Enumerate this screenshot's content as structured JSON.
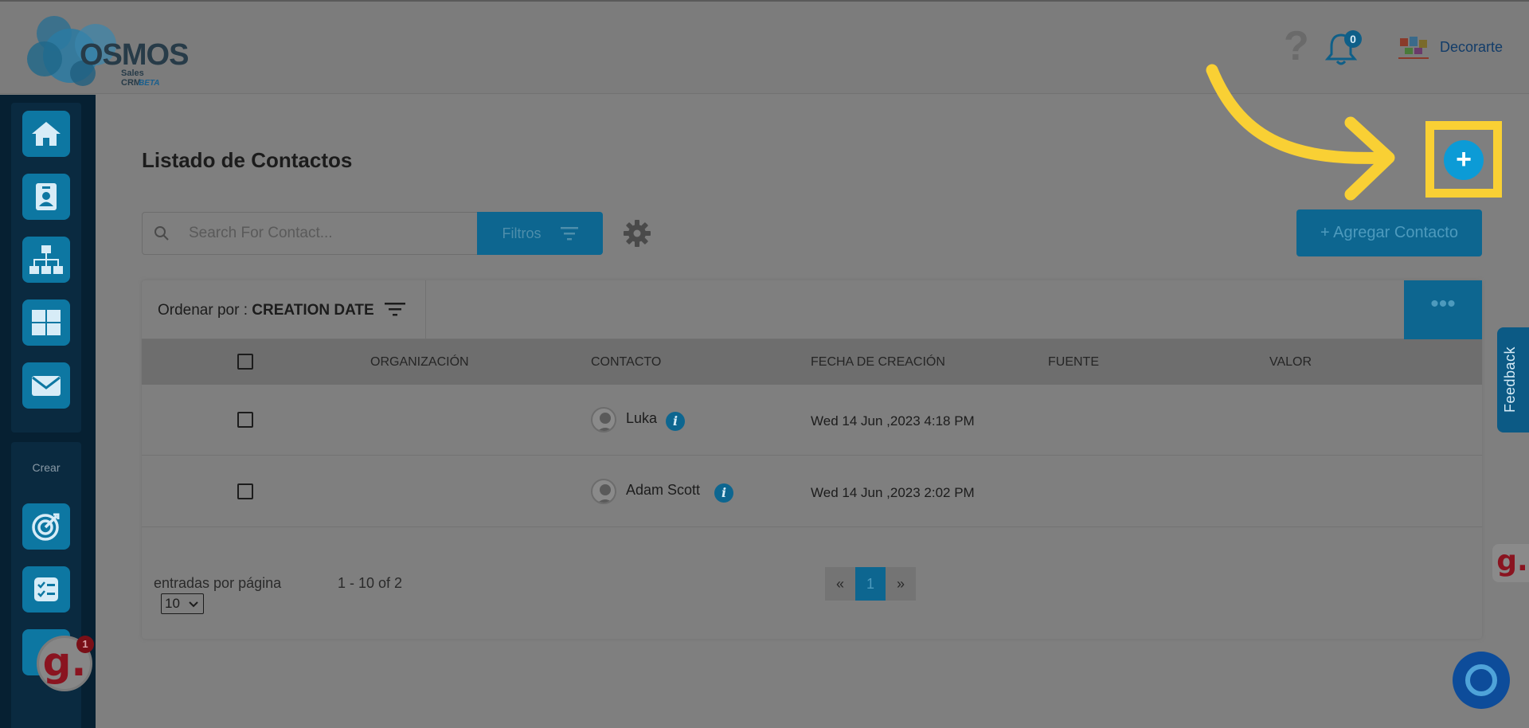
{
  "brand": {
    "logo_text": "OSMOS",
    "logo_sub": "Sales CRM",
    "logo_tag": "BETA"
  },
  "header": {
    "help_icon": "question-mark-icon",
    "notification_count": "0",
    "company_name": "Decorarte"
  },
  "sidebar": {
    "items": [
      {
        "icon": "home-icon"
      },
      {
        "icon": "contact-card-icon"
      },
      {
        "icon": "org-chart-icon"
      },
      {
        "icon": "grid-icon"
      },
      {
        "icon": "mail-icon"
      }
    ],
    "create_label": "Crear",
    "create_items": [
      {
        "icon": "target-icon"
      },
      {
        "icon": "task-list-icon"
      }
    ]
  },
  "main": {
    "title": "Listado de Contactos",
    "search_placeholder": "Search For Contact...",
    "filter_label": "Filtros",
    "add_contact_label": "+ Agregar Contacto",
    "plus_symbol": "+"
  },
  "table": {
    "sort_label": "Ordenar por : ",
    "sort_value": "CREATION DATE",
    "more_label": "•••",
    "columns": [
      "ORGANIZACIÓN",
      "CONTACTO",
      "FECHA DE CREACIÓN",
      "FUENTE",
      "VALOR"
    ],
    "rows": [
      {
        "organization": "",
        "contact": "Luka",
        "created": "Wed 14 Jun ,2023 4:18 PM",
        "source": "",
        "value": ""
      },
      {
        "organization": "",
        "contact": "Adam Scott",
        "created": "Wed 14 Jun ,2023 2:02 PM",
        "source": "",
        "value": ""
      }
    ],
    "info_symbol": "i",
    "per_page_label": "entradas por página",
    "per_page_value": "10",
    "range_text": "1 - 10 of 2",
    "pagination": {
      "prev": "«",
      "current": "1",
      "next": "»"
    }
  },
  "widgets": {
    "feedback_label": "Feedback",
    "g_letter": "g.",
    "g_badge": "1"
  },
  "colors": {
    "accent": "#0c9bd6",
    "highlight": "#f9d034",
    "sidebar_bg": "#062032"
  }
}
